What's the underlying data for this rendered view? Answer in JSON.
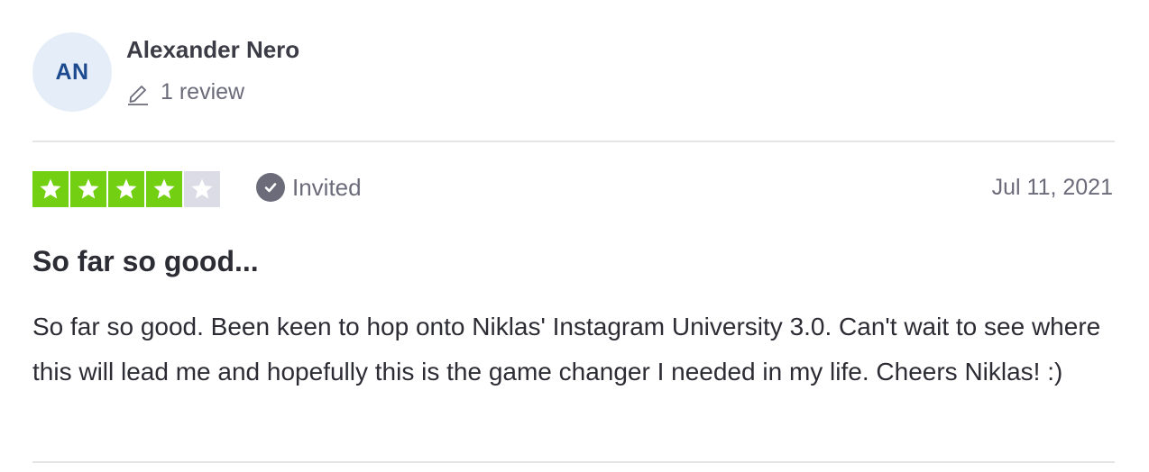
{
  "consumer": {
    "initials": "AN",
    "name": "Alexander Nero",
    "review_count": "1 review",
    "avatar_bg": "#e4edf8",
    "avatar_fg": "#1e4b8f"
  },
  "rating": {
    "value": 4,
    "max": 5,
    "filled_color": "#73cf11",
    "empty_color": "#dcdce6"
  },
  "verification": {
    "label": "Invited",
    "icon": "check-circle-icon"
  },
  "date": "Jul 11, 2021",
  "review": {
    "title": "So far so good...",
    "text": "So far so good. Been keen to hop onto Niklas' Instagram University 3.0. Can't wait to see where this will lead me and hopefully this is the game changer I needed in my life. Cheers Niklas! :)"
  }
}
